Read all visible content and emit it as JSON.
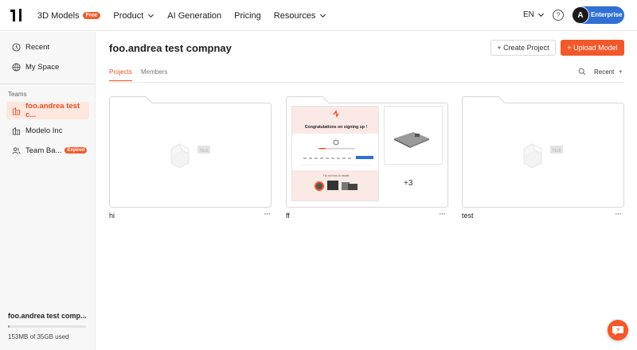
{
  "nav": {
    "items": [
      {
        "label": "3D Models",
        "badge": "Free"
      },
      {
        "label": "Product"
      },
      {
        "label": "AI Generation"
      },
      {
        "label": "Pricing"
      },
      {
        "label": "Resources"
      }
    ],
    "language": "EN",
    "help_glyph": "?",
    "user_initial": "A",
    "plan": "Enterprise"
  },
  "sidebar": {
    "items": [
      {
        "label": "Recent",
        "icon": "clock-icon"
      },
      {
        "label": "My Space",
        "icon": "globe-icon"
      }
    ],
    "teams_label": "Teams",
    "teams": [
      {
        "label": "foo.andrea test c...",
        "icon": "building-icon",
        "active": true
      },
      {
        "label": "Modelo Inc",
        "icon": "building-icon"
      },
      {
        "label": "Team Ba...",
        "icon": "users-icon",
        "badge": "Expired"
      }
    ],
    "footer": {
      "team_name": "foo.andrea test comp...",
      "storage_text": "153MB of 35GB used",
      "storage_used_fraction": 0.004
    }
  },
  "main": {
    "title": "foo.andrea test compnay",
    "create_label": "+ Create Project",
    "upload_label": "+ Upload Model",
    "tabs": [
      "Projects",
      "Members"
    ],
    "sort_label": "Recent",
    "folders": [
      {
        "name": "hi",
        "placeholder": "Null"
      },
      {
        "name": "ff",
        "thumb_title": "Congratulations on signing up !",
        "thumb_sub": "Try out how to model",
        "more_count": "+3"
      },
      {
        "name": "test",
        "placeholder": "Null"
      }
    ],
    "more_glyph": "···"
  },
  "colors": {
    "accent": "#f2582a",
    "plan_blue": "#2f6fd6"
  }
}
